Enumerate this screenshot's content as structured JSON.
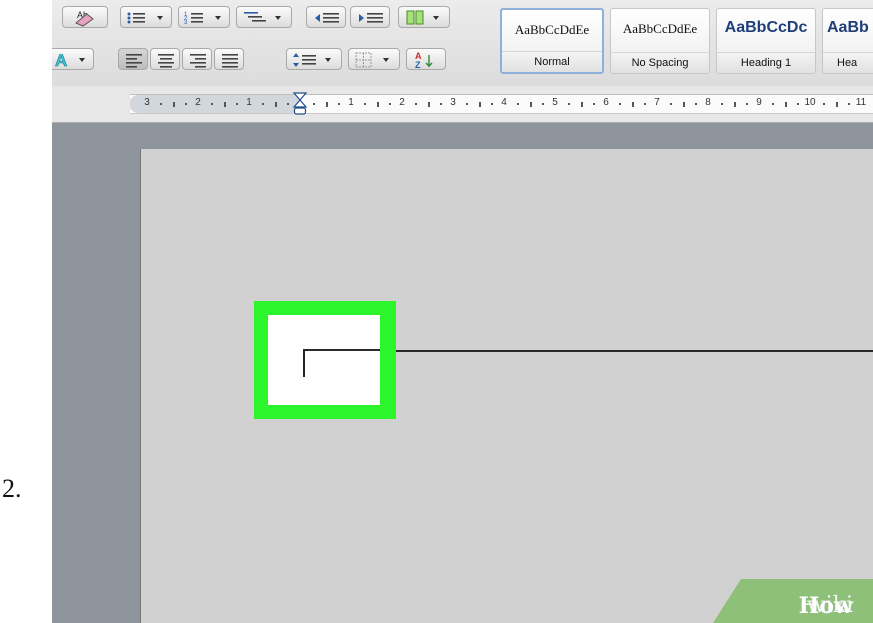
{
  "step_number": "2.",
  "styles_gallery": {
    "styles": [
      {
        "sample": "AaBbCcDdEe",
        "name": "Normal",
        "selected": true
      },
      {
        "sample": "AaBbCcDdEe",
        "name": "No Spacing",
        "selected": false
      },
      {
        "sample": "AaBbCcDc",
        "name": "Heading 1",
        "selected": false
      },
      {
        "sample": "AaBb",
        "name": "Hea",
        "selected": false
      }
    ]
  },
  "ruler": {
    "labels": [
      "3",
      "2",
      "1",
      "1",
      "2",
      "3",
      "4",
      "5",
      "6",
      "7",
      "8",
      "9",
      "10",
      "11"
    ]
  },
  "highlight_color": "#2cf52c",
  "watermark": {
    "part1": "wiki",
    "part2": "How"
  }
}
